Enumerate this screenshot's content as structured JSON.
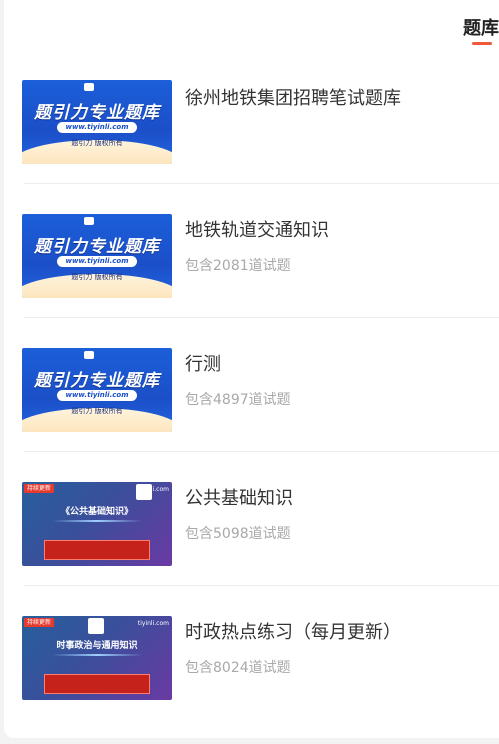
{
  "tabs": {
    "active_label": "题库"
  },
  "thumbnails": {
    "blue_title": "题引力专业题库",
    "blue_url": "www.tiyinli.com",
    "blue_rights": "题引力 版权所有",
    "purple_tag": "持续更新",
    "purple_site": "tiyinli.com",
    "purple_title_4": "《公共基础知识》",
    "purple_title_5": "时事政治与通用知识"
  },
  "items": [
    {
      "title": "徐州地铁集团招聘笔试题库",
      "subtitle": ""
    },
    {
      "title": "地铁轨道交通知识",
      "subtitle": "包含2081道试题"
    },
    {
      "title": "行测",
      "subtitle": "包含4897道试题"
    },
    {
      "title": "公共基础知识",
      "subtitle": "包含5098道试题"
    },
    {
      "title": "时政热点练习（每月更新）",
      "subtitle": "包含8024道试题"
    }
  ],
  "colors": {
    "accent": "#ef5a3c",
    "title_text": "#333333",
    "subtitle_text": "#a9a9a9"
  }
}
